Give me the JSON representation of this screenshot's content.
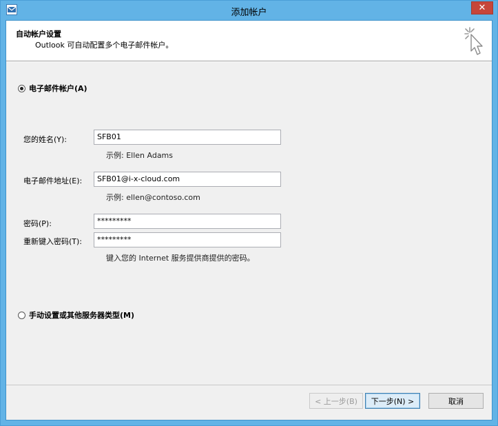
{
  "window": {
    "title": "添加帐户",
    "close_glyph": "✕"
  },
  "header": {
    "title": "自动帐户设置",
    "subtitle": "Outlook 可自动配置多个电子邮件帐户。"
  },
  "email_account": {
    "radio_label": "电子邮件帐户(A)",
    "selected": true,
    "name_label": "您的姓名(Y):",
    "name_value": "SFB01",
    "name_hint": "示例: Ellen Adams",
    "email_label": "电子邮件地址(E):",
    "email_value": "SFB01@i-x-cloud.com",
    "email_hint": "示例: ellen@contoso.com",
    "password_label": "密码(P):",
    "password_value": "*********",
    "retype_label": "重新键入密码(T):",
    "retype_value": "*********",
    "password_hint": "键入您的 Internet 服务提供商提供的密码。"
  },
  "manual_setup": {
    "radio_label": "手动设置或其他服务器类型(M)",
    "selected": false
  },
  "buttons": {
    "back": "< 上一步(B)",
    "next": "下一步(N) >",
    "cancel": "取消"
  },
  "colors": {
    "title_bar": "#62b3e6",
    "close_button": "#c7463a",
    "dialog_body": "#f0f0f0"
  },
  "icons": {
    "app": "outlook-icon",
    "wizard": "wizard-cursor-icon"
  }
}
